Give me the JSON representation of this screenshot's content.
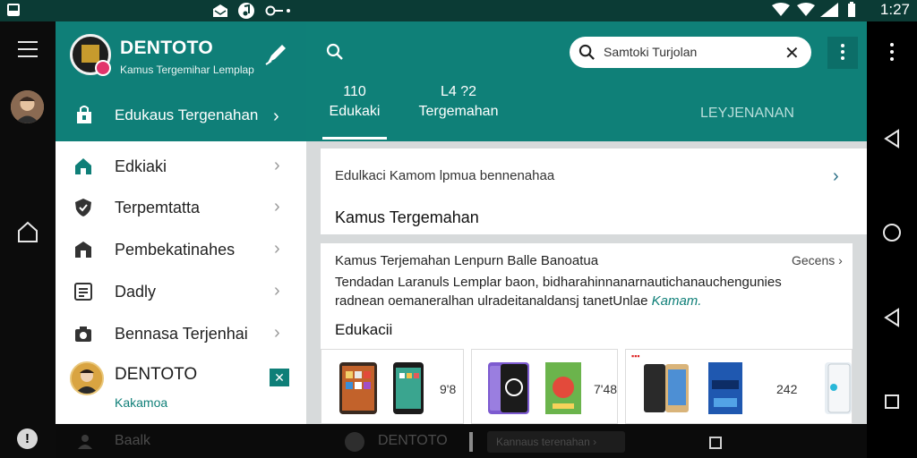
{
  "status": {
    "time": "1:27"
  },
  "drawer": {
    "brand": "DENTOTO",
    "subtitle": "Kamus Tergemihar Lemplap",
    "header_item": "Edukaus Tergenahan",
    "items": [
      {
        "label": "Edkiaki",
        "icon": "home-icon"
      },
      {
        "label": "Terpemtatta",
        "icon": "shield-icon"
      },
      {
        "label": "Pembekatinahes",
        "icon": "store-icon"
      },
      {
        "label": "Dadly",
        "icon": "news-icon"
      },
      {
        "label": "Bennasa Terjenhai",
        "icon": "camera-icon"
      }
    ],
    "profile": {
      "name": "DENTOTO",
      "sub": "Kakamoa",
      "action": "✕"
    }
  },
  "header": {
    "search_value": "Samtoki Turjolan",
    "tabs": [
      {
        "num": "110",
        "label": "Edukaki"
      },
      {
        "num": "L4 ?2",
        "label": "Tergemahan"
      }
    ],
    "right_label": "LEYJENANAN"
  },
  "content": {
    "card1": {
      "line1": "Edulkaci Kamom lpmua bennenahaa",
      "line2": "Kamus Tergemahan"
    },
    "card2": {
      "title": "Kamus Terjemahan Lenpurn Balle Banoatua",
      "more": "Gecens",
      "body": "Tendadan Laranuls Lemplar baon, bidharahinnanarnautichanauchengunies radnean oemaneralhan ulradeitanaldansj tanetUnlae",
      "body_link": "Kamam.",
      "section": "Edukacii",
      "products": [
        {
          "price": "9'8"
        },
        {
          "price": "7'48"
        },
        {
          "price": "242"
        }
      ]
    }
  },
  "bottombar": {
    "left": "Baalk",
    "center": "DENTOTO",
    "chip": "Kannaus terenahan"
  },
  "colors": {
    "teal": "#0f8078",
    "teal_dark": "#0b3b35",
    "accent_pink": "#e2346b"
  }
}
